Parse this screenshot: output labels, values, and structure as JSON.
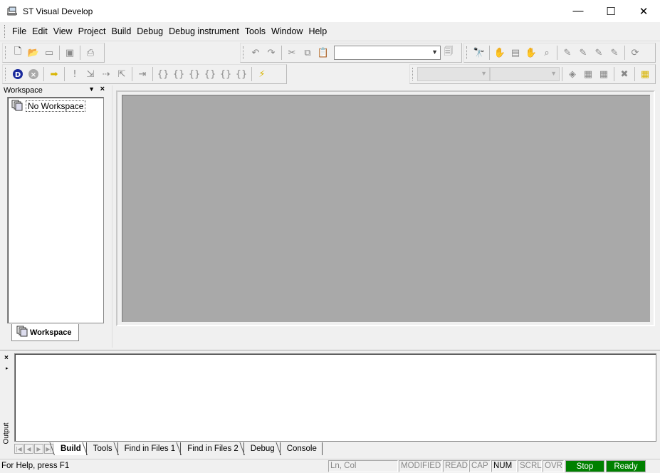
{
  "window": {
    "title": "ST Visual Develop",
    "minimize": "—",
    "maximize": "☐",
    "close": "✕"
  },
  "menu": [
    "File",
    "Edit",
    "View",
    "Project",
    "Build",
    "Debug",
    "Debug instrument",
    "Tools",
    "Window",
    "Help"
  ],
  "workspace": {
    "header": "Workspace",
    "tree_item": "No Workspace",
    "tab_label": "Workspace"
  },
  "output": {
    "side_label": "Output",
    "tabs": [
      "Build",
      "Tools",
      "Find in Files 1",
      "Find in Files 2",
      "Debug",
      "Console"
    ],
    "active_tab": "Build"
  },
  "status": {
    "help": "For Help, press F1",
    "position": "Ln, Col",
    "modified": "MODIFIED",
    "read": "READ",
    "cap": "CAP",
    "num": "NUM",
    "scrl": "SCRL",
    "ovr": "OVR",
    "stop": "Stop",
    "ready": "Ready"
  },
  "colors": {
    "mdi_background": "#a9a9a9",
    "status_green": "#008000"
  }
}
